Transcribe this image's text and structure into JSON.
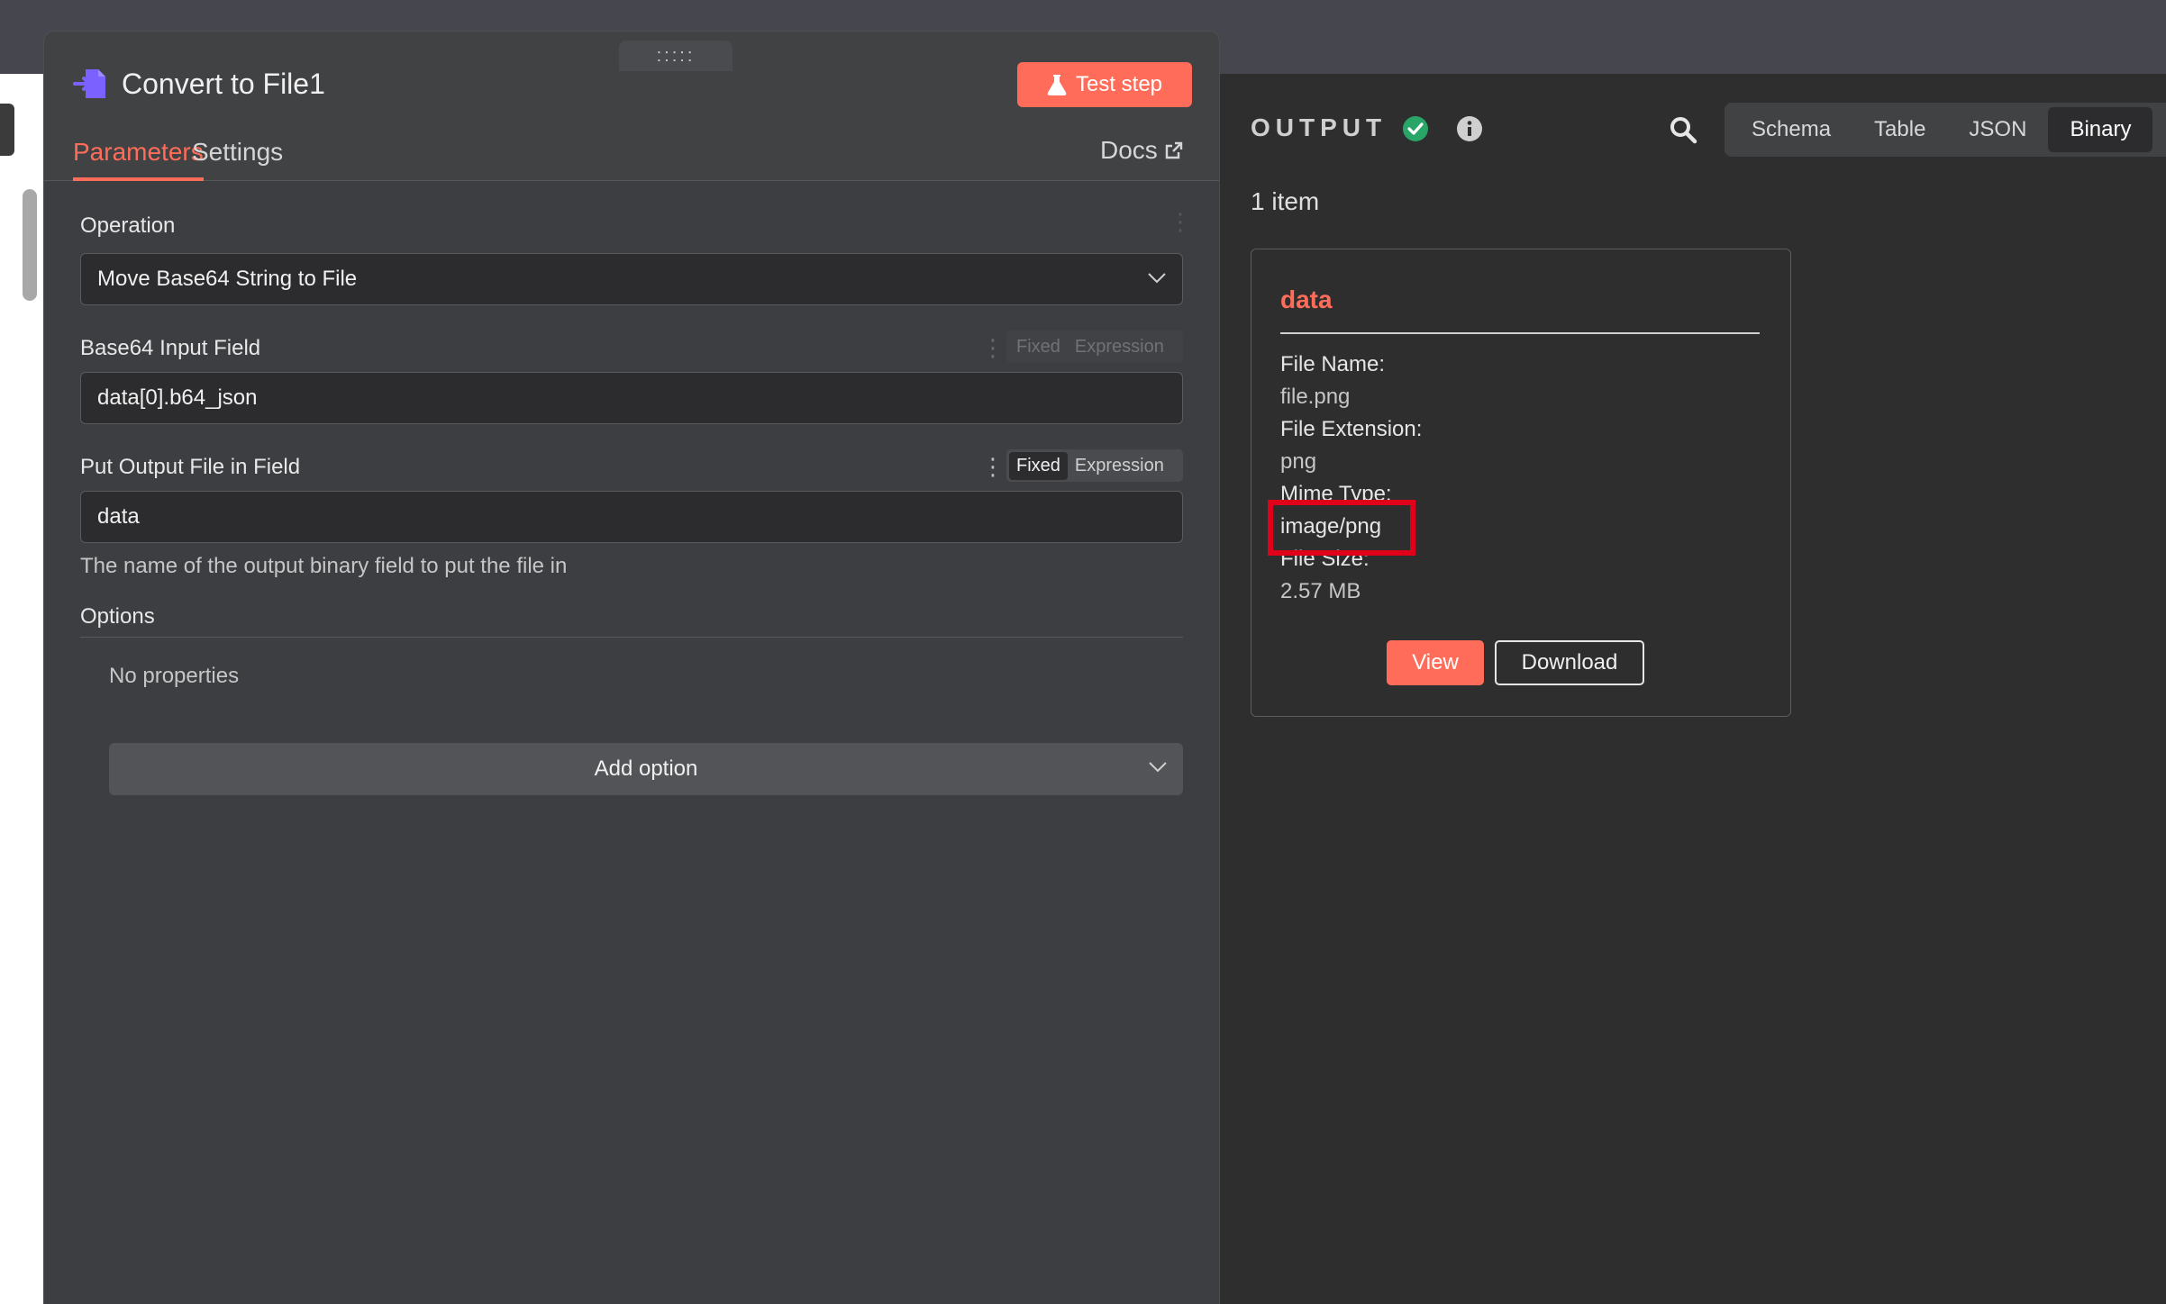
{
  "node": {
    "title": "Convert to File1",
    "icon": "file-arrow-icon",
    "drag_handle": ":::::",
    "test_step_label": "Test step",
    "tabs": [
      {
        "label": "Parameters",
        "active": true
      },
      {
        "label": "Settings",
        "active": false
      }
    ],
    "docs_label": "Docs"
  },
  "parameters": {
    "operation": {
      "label": "Operation",
      "value": "Move Base64 String to File"
    },
    "base64_input": {
      "label": "Base64 Input Field",
      "value": "data[0].b64_json",
      "mode_fixed": "Fixed",
      "mode_expression": "Expression"
    },
    "output_field": {
      "label": "Put Output File in Field",
      "value": "data",
      "mode_fixed": "Fixed",
      "mode_expression": "Expression",
      "hint": "The name of the output binary field to put the file in"
    },
    "options": {
      "label": "Options",
      "empty_text": "No properties",
      "add_label": "Add option"
    }
  },
  "output": {
    "title": "OUTPUT",
    "status_color": "#29a568",
    "view_tabs": [
      {
        "label": "Schema",
        "active": false
      },
      {
        "label": "Table",
        "active": false
      },
      {
        "label": "JSON",
        "active": false
      },
      {
        "label": "Binary",
        "active": true
      }
    ],
    "item_count": "1 item",
    "binary": {
      "name": "data",
      "file_name_key": "File Name:",
      "file_name": "file.png",
      "file_ext_key": "File Extension:",
      "file_ext": "png",
      "mime_key": "Mime Type:",
      "mime": "image/png",
      "size_key": "File Size:",
      "size": "2.57 MB",
      "view_label": "View",
      "download_label": "Download"
    }
  },
  "colors": {
    "accent": "#ff6d5a",
    "highlight": "#e0001a"
  }
}
